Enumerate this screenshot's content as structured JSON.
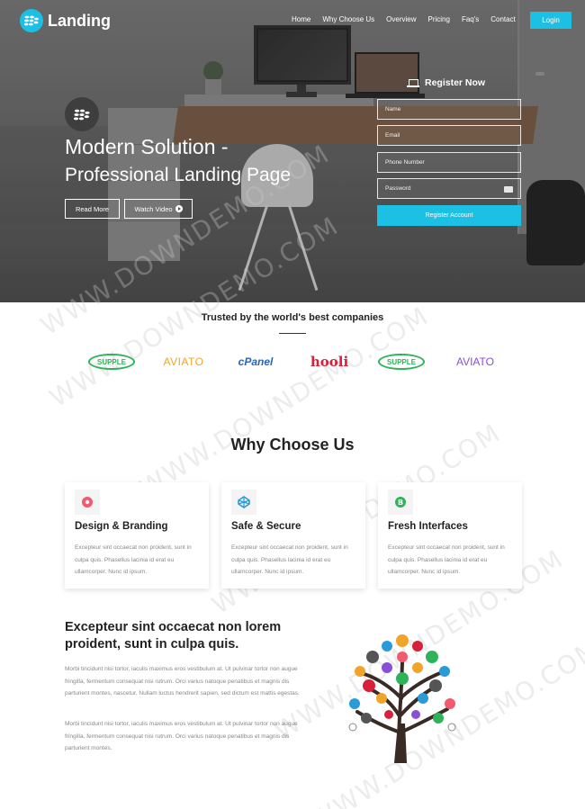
{
  "brand": {
    "name": "Landing",
    "accent_color": "#1cc0e4",
    "logo_icon": "blackberry-icon"
  },
  "nav": {
    "items": [
      "Home",
      "Why Choose Us",
      "Overview",
      "Pricing",
      "Faq's",
      "Contact"
    ],
    "login_label": "Login"
  },
  "hero": {
    "badge_icon": "blackberry-icon",
    "title": "Modern Solution -",
    "subtitle": "Professional Landing Page",
    "read_more_label": "Read More",
    "watch_video_label": "Watch Video",
    "watch_video_icon": "play-circle-icon"
  },
  "register": {
    "title": "Register Now",
    "title_icon": "laptop-icon",
    "fields": [
      {
        "placeholder": "Name"
      },
      {
        "placeholder": "Email"
      },
      {
        "placeholder": "Phone Number"
      },
      {
        "placeholder": "Password",
        "icon": "key-icon"
      }
    ],
    "submit_label": "Register Account"
  },
  "trusted": {
    "title": "Trusted by the world's best companies",
    "brands": [
      "SUPPLE",
      "AVIATO",
      "cPanel",
      "hooli",
      "SUPPLE",
      "AVIATO"
    ]
  },
  "why": {
    "title": "Why Choose Us",
    "features": [
      {
        "icon": "palette-icon",
        "icon_color": "#f25a6e",
        "title": "Design & Branding",
        "text": "Excepteur sint occaecat non proident, sunt in culpa quis. Phasellus lacinia id erat eu ullamcorper. Nunc id ipsum."
      },
      {
        "icon": "codepen-icon",
        "icon_color": "#2a9bd6",
        "title": "Safe & Secure",
        "text": "Excepteur sint occaecat non proident, sunt in culpa quis. Phasellus lacinia id erat eu ullamcorper. Nunc id ipsum."
      },
      {
        "icon": "bitcoin-icon",
        "icon_color": "#2fb35a",
        "title": "Fresh Interfaces",
        "text": "Excepteur sint occaecat non proident, sunt in culpa quis. Phasellus lacinia id erat eu ullamcorper. Nunc id ipsum."
      }
    ]
  },
  "about": {
    "title": "Excepteur sint occaecat non lorem proident, sunt in culpa quis.",
    "paragraphs": [
      "Morbi tincidunt nisi tortor, iaculis maximus eros vestibulum at. Ut pulvinar tortor non augue fringilla, fermentum consequat nisi rutrum. Orci varius natoque penatibus et magnis dis parturient montes, nascetur. Nullam luctus hendrerit sapien, sed dictum est mattis egestas.",
      "Morbi tincidunt nisi tortor, iaculis maximus eros vestibulum at. Ut pulvinar tortor non augue fringilla, fermentum consequat nisi rutrum. Orci varius natoque penatibus et magnis dis parturient montes."
    ],
    "illustration": "tree-icons-illustration"
  },
  "watermark": "WWW.DOWNDEMO.COM"
}
